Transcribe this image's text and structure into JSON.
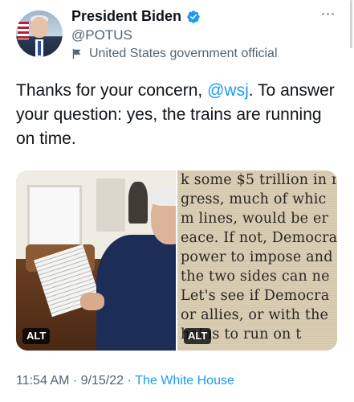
{
  "author": {
    "display_name": "President Biden",
    "handle": "@POTUS",
    "account_label": "United States government official"
  },
  "tweet": {
    "text_before": "Thanks for your concern, ",
    "mention": "@wsj",
    "text_after": ". To answer your question: yes, the trains are running on time."
  },
  "media": {
    "alt_badge_1": "ALT",
    "alt_badge_2": "ALT",
    "clipping_lines": [
      "k some $5 trillion in r",
      "gress, much of whic",
      "m lines, would be er",
      "eace. If not, Democra",
      "power to impose and",
      "the two sides can ne",
      "Let's see if Democra",
      "or allies, or with the",
      "hains to run on t"
    ]
  },
  "meta": {
    "time": "11:54 AM",
    "separator1": " · ",
    "date": "9/15/22",
    "separator2": " · ",
    "source": "The White House"
  },
  "colors": {
    "accent": "#1d9bf0",
    "secondary_text": "#536471",
    "primary_text": "#0f1419"
  },
  "icons": {
    "verified": "verified-badge-icon",
    "label": "government-flag-icon",
    "more": "more-options-icon"
  }
}
